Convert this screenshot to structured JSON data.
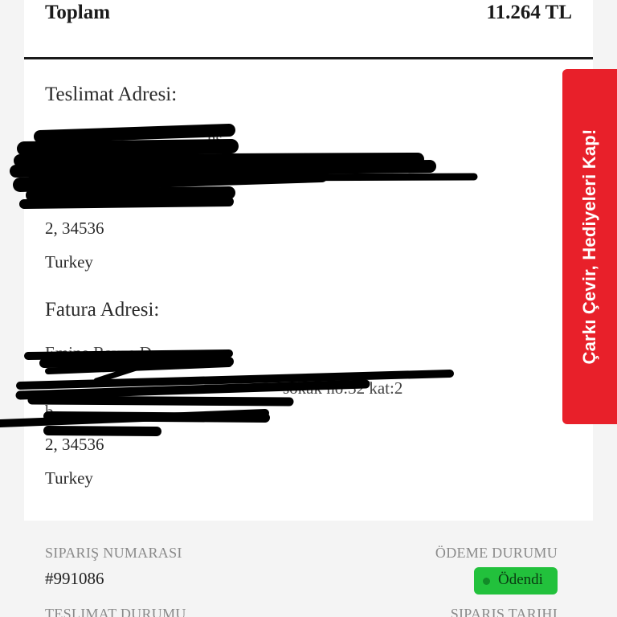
{
  "order_summary": {
    "total_label": "Toplam",
    "total_value": "11.264 TL"
  },
  "shipping": {
    "title": "Teslimat Adresi:",
    "partial_line_1": "ns",
    "visible_lines": [
      "2, 34536",
      "Turkey"
    ]
  },
  "billing": {
    "title": "Fatura Adresi:",
    "partial_line_1": "Emine Ravza D",
    "partial_line_2": "sokak no:32 kat:2",
    "partial_line_3": "b",
    "visible_lines": [
      "2, 34536",
      "Turkey"
    ]
  },
  "promo_tab": {
    "label": "Çarkı Çevir, Hediyeleri Kap!",
    "color": "#e8202a"
  },
  "order_meta": {
    "order_number_label": "SIPARIŞ NUMARASI",
    "order_number": "#991086",
    "payment_status_label": "ÖDEME DURUMU",
    "payment_status": "Ödendi",
    "delivery_status_label": "TESLIMAT DURUMU",
    "order_date_label": "SIPARIŞ TARIHI",
    "status_color": "#22c13c"
  }
}
